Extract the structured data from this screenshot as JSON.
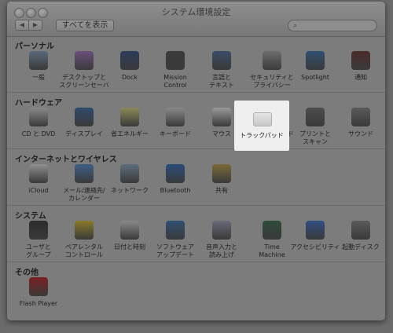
{
  "window": {
    "title": "システム環境設定"
  },
  "toolbar": {
    "back": "◀",
    "forward": "▶",
    "show_all": "すべてを表示",
    "search_icon": "search-icon"
  },
  "sections": [
    {
      "title": "パーソナル",
      "items": [
        {
          "label": "一般",
          "icon": "general-icon",
          "color": "#5a6a7a"
        },
        {
          "label": "デスクトップと\nスクリーンセーバ",
          "icon": "desktop-icon",
          "color": "#6b4f7a"
        },
        {
          "label": "Dock",
          "icon": "dock-icon",
          "color": "#2d3d5a"
        },
        {
          "label": "Mission\nControl",
          "icon": "mission-control-icon",
          "color": "#3b3b3b"
        },
        {
          "label": "言語と\nテキスト",
          "icon": "language-icon",
          "color": "#3a4d66"
        },
        {
          "label": "セキュリティと\nプライバシー",
          "icon": "security-icon",
          "color": "#6d6d6d"
        },
        {
          "label": "Spotlight",
          "icon": "spotlight-icon",
          "color": "#2f4f73"
        },
        {
          "label": "通知",
          "icon": "notifications-icon",
          "color": "#4b2b2b"
        }
      ]
    },
    {
      "title": "ハードウェア",
      "items": [
        {
          "label": "CD と DVD",
          "icon": "cd-dvd-icon",
          "color": "#8a8a8a"
        },
        {
          "label": "ディスプレイ",
          "icon": "display-icon",
          "color": "#2f4a6b"
        },
        {
          "label": "省エネルギー",
          "icon": "energy-saver-icon",
          "color": "#8c8a5a"
        },
        {
          "label": "キーボード",
          "icon": "keyboard-icon",
          "color": "#8a8a8a"
        },
        {
          "label": "マウス",
          "icon": "mouse-icon",
          "color": "#9a9a9a"
        },
        {
          "label": "トラックパッド",
          "icon": "trackpad-icon",
          "color": "#d9d9d9"
        },
        {
          "label": "プリントと\nスキャン",
          "icon": "print-scan-icon",
          "color": "#4d4d4d"
        },
        {
          "label": "サウンド",
          "icon": "sound-icon",
          "color": "#5a5a5a"
        }
      ]
    },
    {
      "title": "インターネットとワイヤレス",
      "items": [
        {
          "label": "iCloud",
          "icon": "icloud-icon",
          "color": "#8f8f8f"
        },
        {
          "label": "メール/連絡先/\nカレンダー",
          "icon": "mail-contacts-icon",
          "color": "#3f5f86"
        },
        {
          "label": "ネットワーク",
          "icon": "network-icon",
          "color": "#5e6e7e"
        },
        {
          "label": "Bluetooth",
          "icon": "bluetooth-icon",
          "color": "#2a4c7a"
        },
        {
          "label": "共有",
          "icon": "sharing-icon",
          "color": "#7a6a3a"
        }
      ]
    },
    {
      "title": "システム",
      "items": [
        {
          "label": "ユーザと\nグループ",
          "icon": "users-groups-icon",
          "color": "#2b2b2b"
        },
        {
          "label": "ペアレンタル\nコントロール",
          "icon": "parental-controls-icon",
          "color": "#8a7a2a"
        },
        {
          "label": "日付と時刻",
          "icon": "date-time-icon",
          "color": "#8a8a8a"
        },
        {
          "label": "ソフトウェア\nアップデート",
          "icon": "software-update-icon",
          "color": "#2f4f73"
        },
        {
          "label": "音声入力と\n読み上げ",
          "icon": "dictation-speech-icon",
          "color": "#6a6a7a"
        },
        {
          "label": "Time\nMachine",
          "icon": "time-machine-icon",
          "color": "#2f4a3a"
        },
        {
          "label": "アクセシビリティ",
          "icon": "accessibility-icon",
          "color": "#2f4f83"
        },
        {
          "label": "起動ディスク",
          "icon": "startup-disk-icon",
          "color": "#5a5a5a"
        }
      ]
    },
    {
      "title": "その他",
      "items": [
        {
          "label": "Flash Player",
          "icon": "flash-player-icon",
          "color": "#7a2020"
        }
      ]
    }
  ]
}
